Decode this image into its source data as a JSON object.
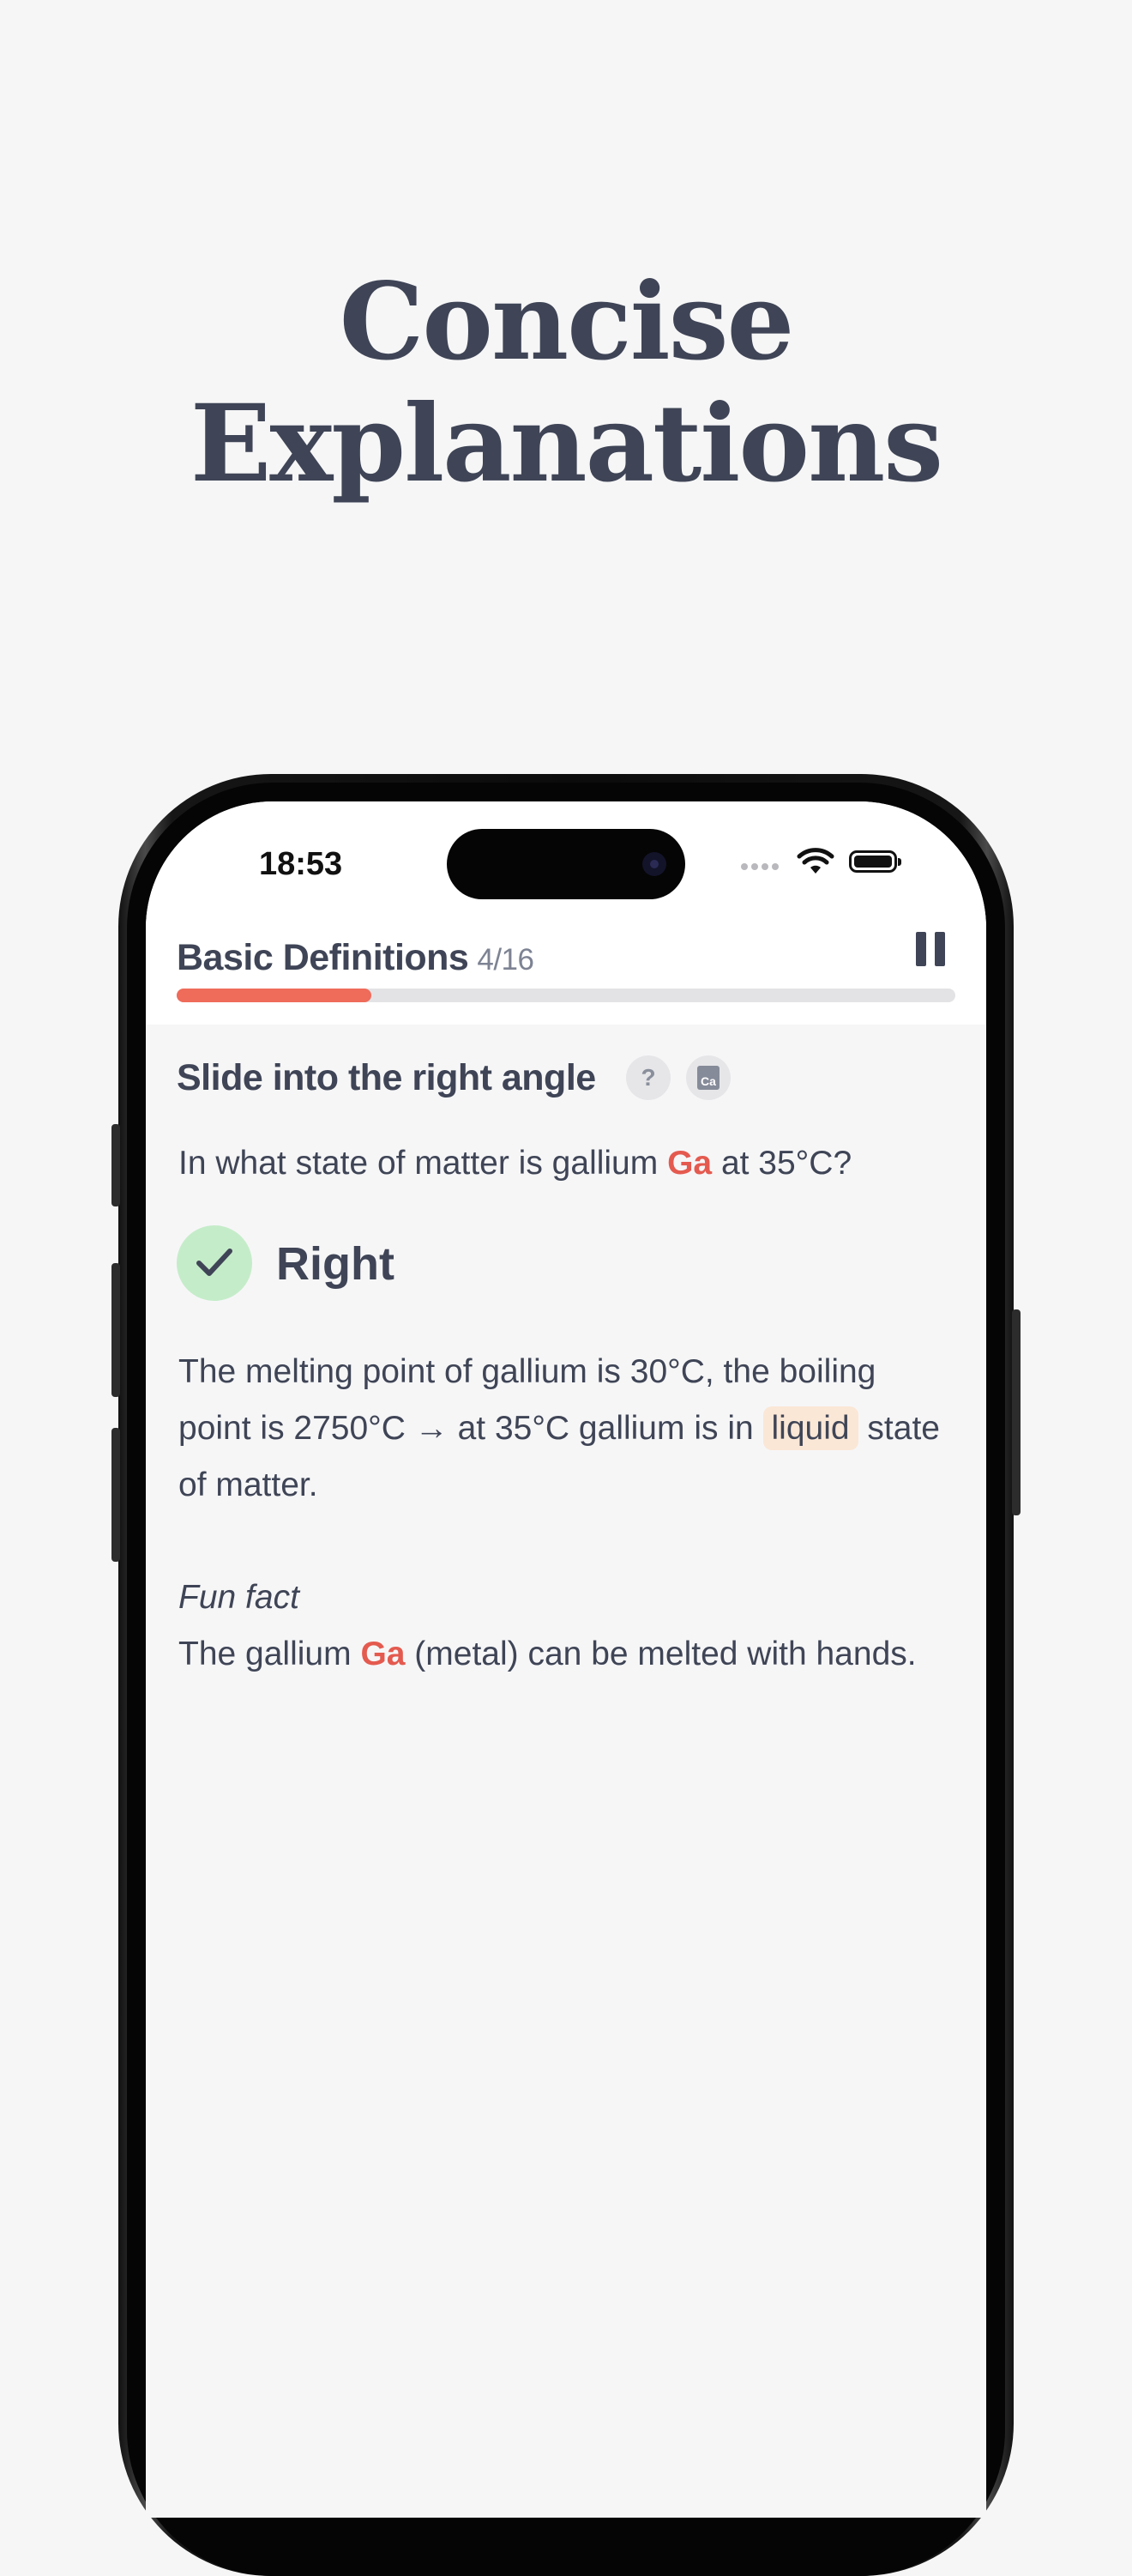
{
  "headline": {
    "line1": "Concise",
    "line2": "Explanations"
  },
  "status_bar": {
    "time": "18:53",
    "icons": [
      "signal-icon",
      "wifi-icon",
      "battery-icon"
    ]
  },
  "lesson": {
    "title": "Basic Definitions",
    "progress_text": "4/16",
    "progress_fraction": 0.25,
    "pause_icon": "pause-icon"
  },
  "card": {
    "title": "Slide into the right angle",
    "help_icon": "question-mark-icon",
    "help_label": "?",
    "element_icon": "element-tile-icon",
    "element_symbol": "Ca"
  },
  "question": {
    "prefix": "In what state of matter is gallium ",
    "element": "Ga",
    "suffix": " at 35°C?"
  },
  "result": {
    "icon": "checkmark-icon",
    "label": "Right"
  },
  "explanation": {
    "text_before": "The melting point of gallium is 30°C, the boiling point is 2750°C → at 35°C gallium is in ",
    "highlight": "liquid",
    "text_after": " state of matter."
  },
  "fun_fact": {
    "title": "Fun fact",
    "prefix": "The gallium ",
    "element": "Ga",
    "suffix": " (metal) can be melted with hands."
  },
  "colors": {
    "background": "#f6f6f7",
    "text": "#3f4556",
    "accent_red": "#e45a4f",
    "progress": "#ef6b5a",
    "success_bg": "#c5ecc9",
    "highlight_bg": "#fbe7d6"
  }
}
